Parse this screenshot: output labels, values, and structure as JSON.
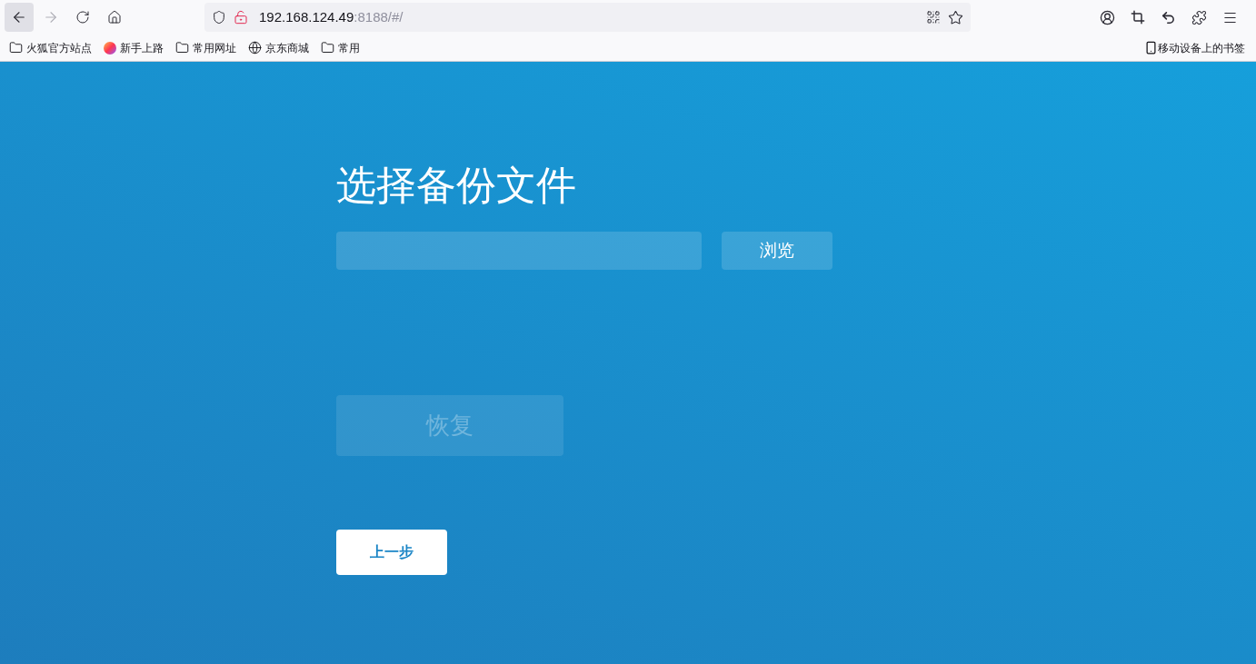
{
  "browser": {
    "url_host": "192.168.124.49",
    "url_rest": ":8188/#/",
    "back_enabled": true,
    "forward_enabled": false
  },
  "bookmarks": [
    {
      "kind": "folder",
      "label": "火狐官方站点"
    },
    {
      "kind": "firefox",
      "label": "新手上路"
    },
    {
      "kind": "folder",
      "label": "常用网址"
    },
    {
      "kind": "globe",
      "label": "京东商城"
    },
    {
      "kind": "folder",
      "label": "常用"
    }
  ],
  "mobile_bookmarks": "移动设备上的书签",
  "page": {
    "title": "选择备份文件",
    "browse_button": "浏览",
    "restore_button": {
      "label": "恢复",
      "disabled": true
    },
    "back_button": "上一步"
  }
}
